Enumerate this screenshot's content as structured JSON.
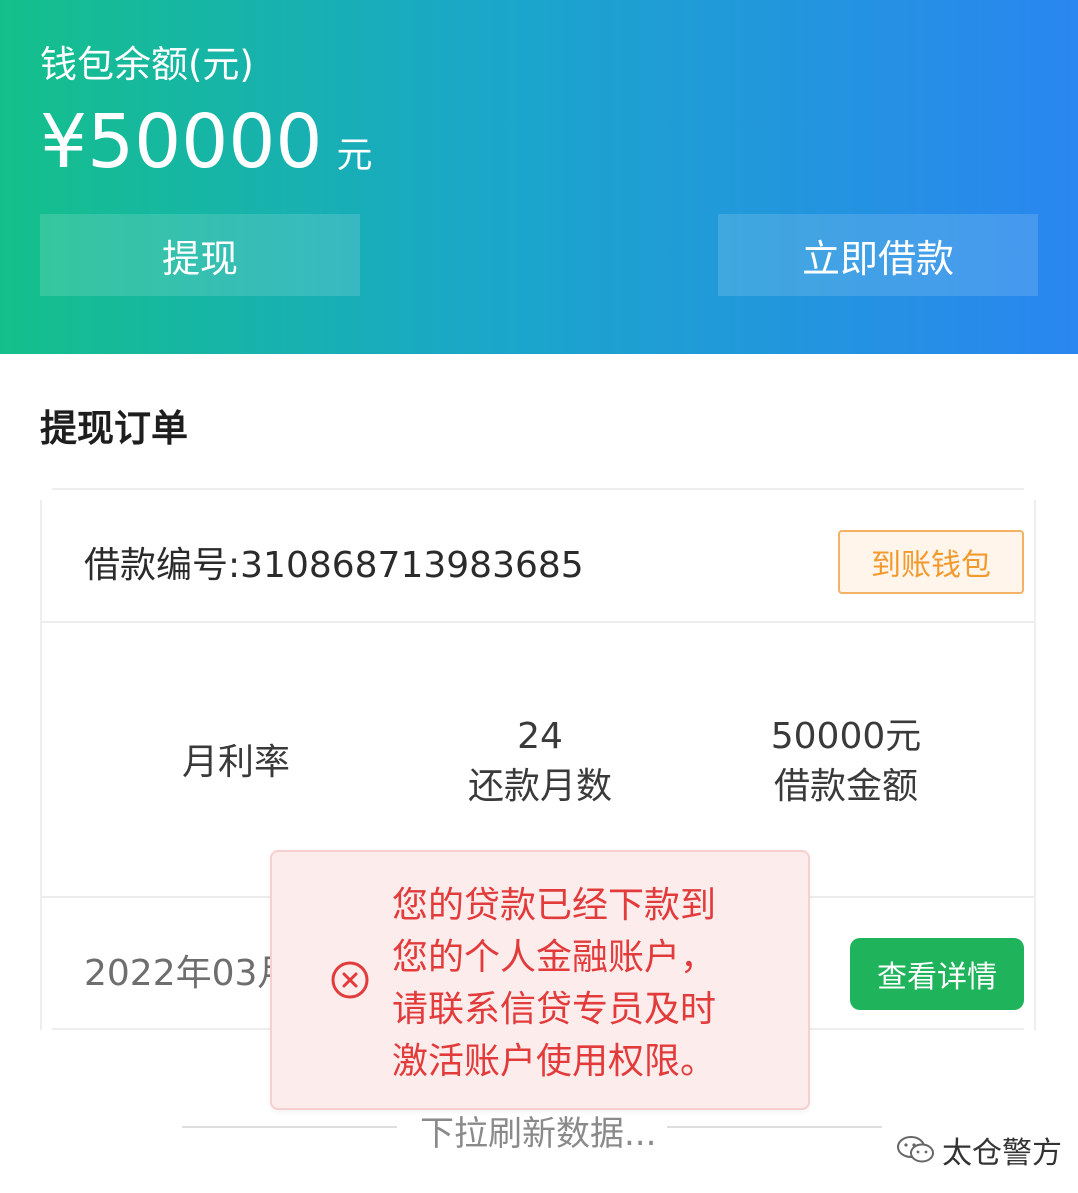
{
  "header": {
    "balance_label": "钱包余额(元)",
    "balance_amount": "¥50000",
    "balance_unit": "元",
    "withdraw_label": "提现",
    "borrow_label": "立即借款"
  },
  "orders": {
    "title": "提现订单",
    "loan_number": "借款编号:310868713983685",
    "status_badge": "到账钱包",
    "monthly_rate_label": "月利率",
    "months_value": "24",
    "months_label": "还款月数",
    "amount_value": "50000元",
    "amount_label": "借款金额",
    "date_partial": "2022年03月",
    "detail_button": "查看详情"
  },
  "refresh_text": "下拉刷新数据...",
  "toast": {
    "line1": "您的贷款已经下款到",
    "line2": "您的个人金融账户，",
    "line3": "请联系信贷专员及时",
    "line4": "激活账户使用权限。"
  },
  "watermark": "太仓警方",
  "colors": {
    "gradient_start": "#14c08a",
    "gradient_end": "#2a86f0",
    "badge_orange": "#f29a2e",
    "detail_green": "#1fb45b",
    "toast_red": "#e23b3b"
  }
}
